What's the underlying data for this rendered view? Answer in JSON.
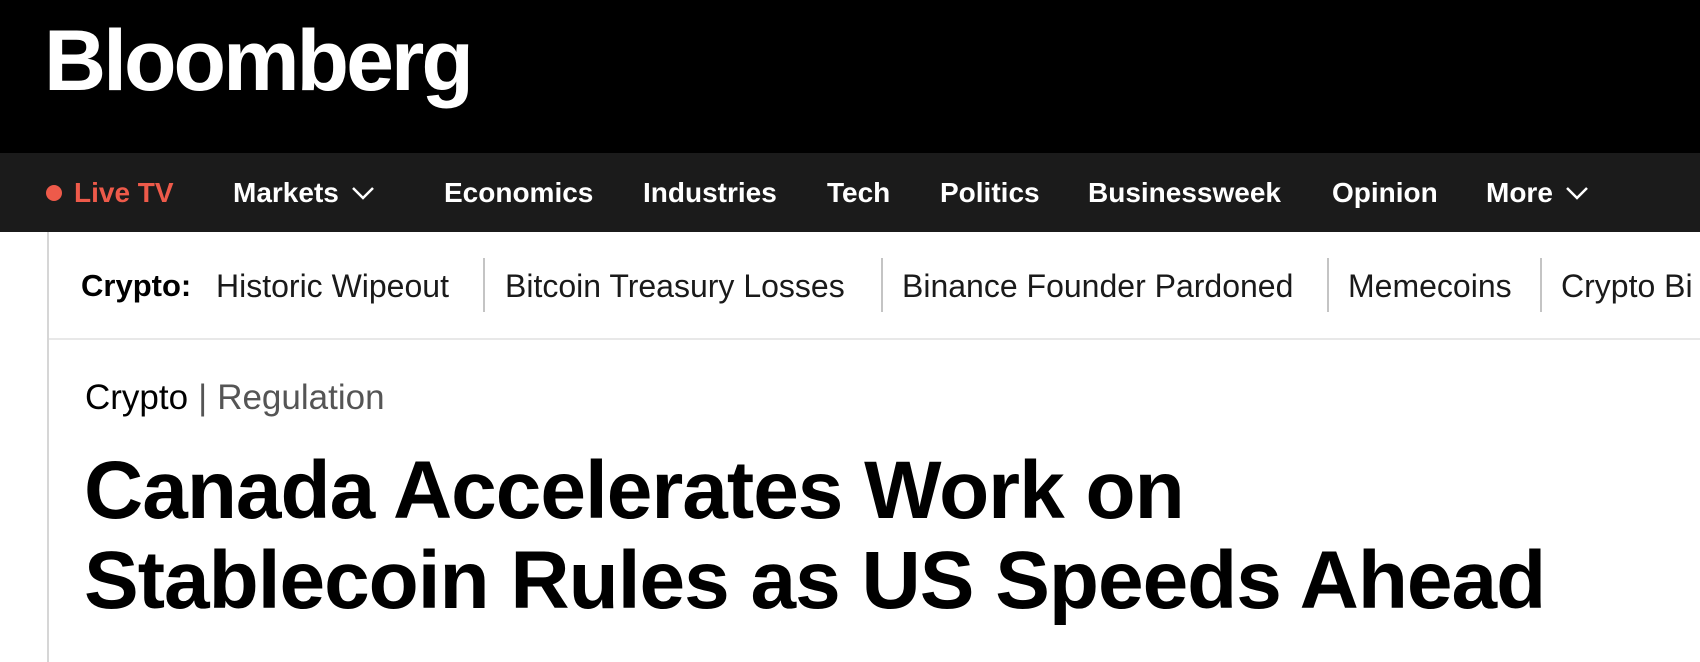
{
  "brand": {
    "logo_text": "Bloomberg"
  },
  "nav": {
    "live_tv_label": "Live TV",
    "items": [
      {
        "label": "Markets",
        "has_dropdown": true
      },
      {
        "label": "Economics",
        "has_dropdown": false
      },
      {
        "label": "Industries",
        "has_dropdown": false
      },
      {
        "label": "Tech",
        "has_dropdown": false
      },
      {
        "label": "Politics",
        "has_dropdown": false
      },
      {
        "label": "Businessweek",
        "has_dropdown": false
      },
      {
        "label": "Opinion",
        "has_dropdown": false
      },
      {
        "label": "More",
        "has_dropdown": true
      }
    ]
  },
  "topics": {
    "label": "Crypto:",
    "links": [
      "Historic Wipeout",
      "Bitcoin Treasury Losses",
      "Binance Founder Pardoned",
      "Memecoins",
      "Crypto Bi"
    ]
  },
  "article": {
    "kicker_primary": "Crypto",
    "kicker_separator": "|",
    "kicker_secondary": "Regulation",
    "headline_line1": "Canada Accelerates Work on",
    "headline_line2": "Stablecoin Rules as US Speeds Ahead"
  },
  "colors": {
    "brand_bar": "#000000",
    "nav_bar": "#1b1b1b",
    "live_accent": "#ee5a4a"
  },
  "icons": {
    "live": "live-dot-icon",
    "dropdown": "chevron-down-icon"
  }
}
